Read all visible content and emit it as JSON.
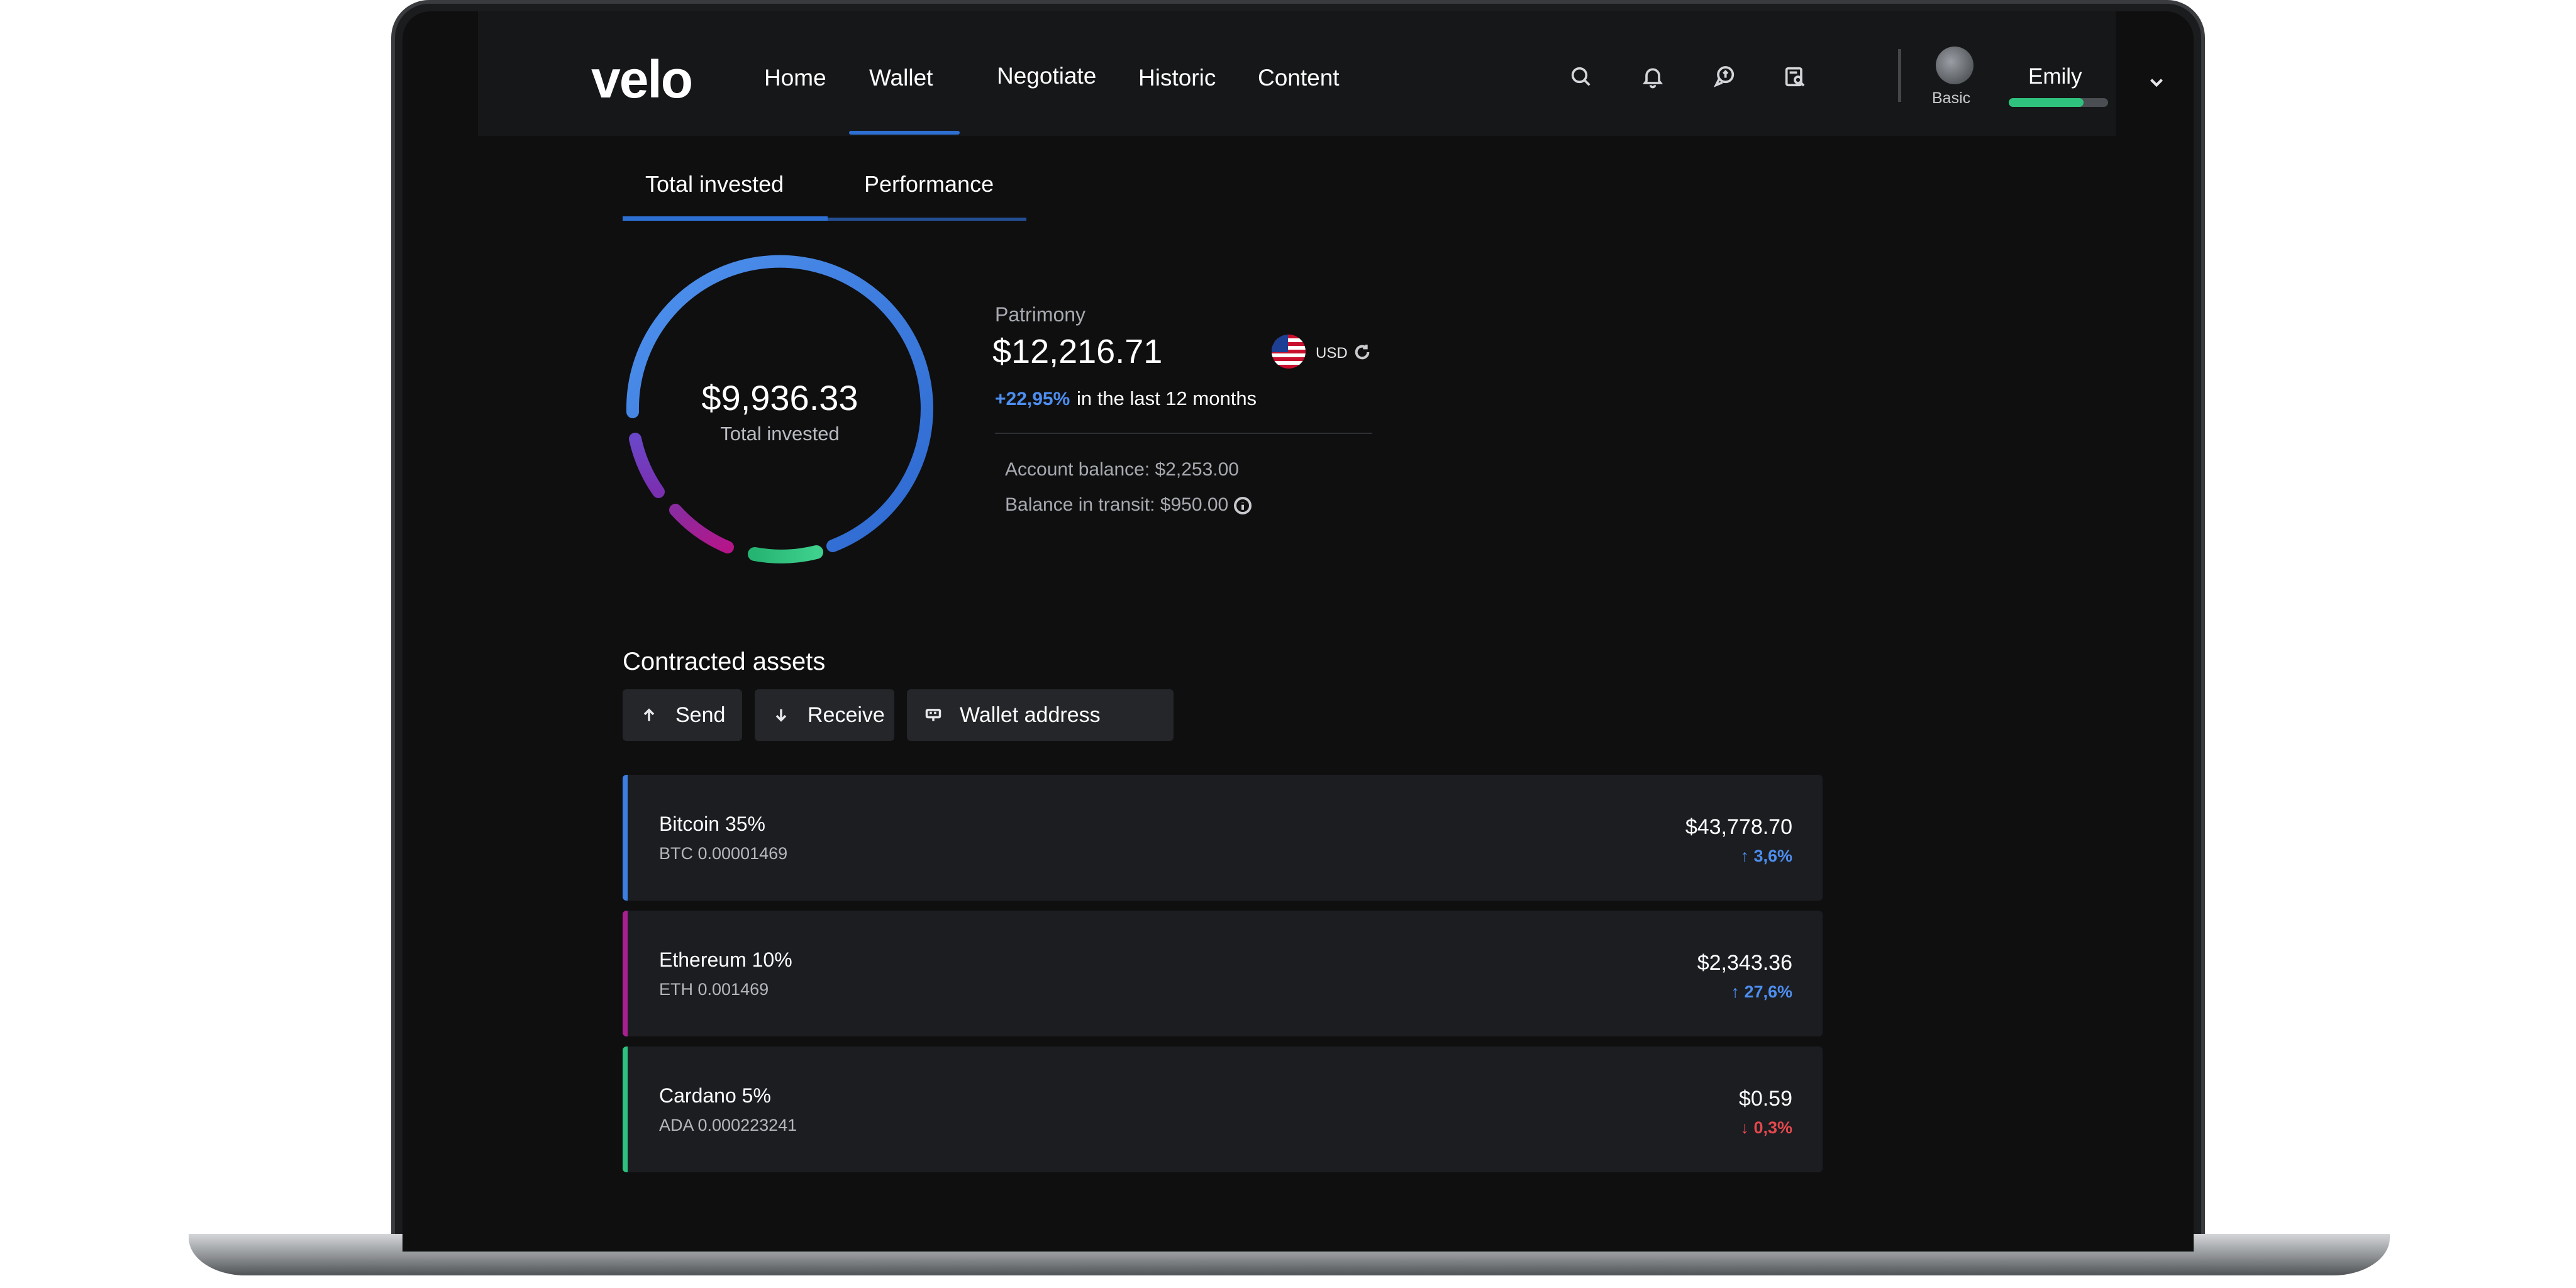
{
  "brand": {
    "logo": "velo"
  },
  "nav": {
    "items": [
      {
        "label": "Home"
      },
      {
        "label": "Wallet"
      },
      {
        "label": "Negotiate"
      },
      {
        "label": "Historic"
      },
      {
        "label": "Content"
      }
    ],
    "active": "Wallet",
    "icons": [
      "search-icon",
      "bell-icon",
      "chat-icon",
      "news-icon"
    ]
  },
  "user": {
    "name": "Emily",
    "plan": "Basic",
    "level": 0.75
  },
  "tabs": {
    "items": [
      "Total invested",
      "Performance"
    ],
    "active": "Total invested"
  },
  "donut": {
    "value": "$9,936.33",
    "label": "Total invested",
    "segments": [
      {
        "asset": "Bitcoin",
        "color": "#3d7fe0"
      },
      {
        "asset": "Ethereum",
        "color": "#a8208f"
      },
      {
        "asset": "Cardano",
        "color": "#2ec27e"
      },
      {
        "asset": "Other",
        "color": "#6a3cc2"
      }
    ]
  },
  "patrimony": {
    "label": "Patrimony",
    "value": "$12,216.71",
    "currency": "USD",
    "change": "+22,95%",
    "change_desc": "in the last 12 months",
    "account_balance": "Account balance: $2,253.00",
    "transit_balance": "Balance in transit: $950.00"
  },
  "assets_section": {
    "title": "Contracted assets",
    "actions": {
      "send": "Send",
      "receive": "Receive",
      "wallet": "Wallet address"
    },
    "items": [
      {
        "name": "Bitcoin 35%",
        "amount": "BTC 0.00001469",
        "price": "$43,778.70",
        "change": "↑ 3,6%",
        "color": "#3d7fe0",
        "trend": "up"
      },
      {
        "name": "Ethereum 10%",
        "amount": "ETH 0.001469",
        "price": "$2,343.36",
        "change": "↑ 27,6%",
        "color": "#a8208f",
        "trend": "up"
      },
      {
        "name": "Cardano 5%",
        "amount": "ADA 0.000223241",
        "price": "$0.59",
        "change": "↓ 0,3%",
        "color": "#2ec27e",
        "trend": "down"
      }
    ]
  },
  "colors": {
    "accent": "#2e6fd4",
    "up": "#4d8ef0",
    "down": "#e5484d",
    "background": "#0f0f10"
  }
}
